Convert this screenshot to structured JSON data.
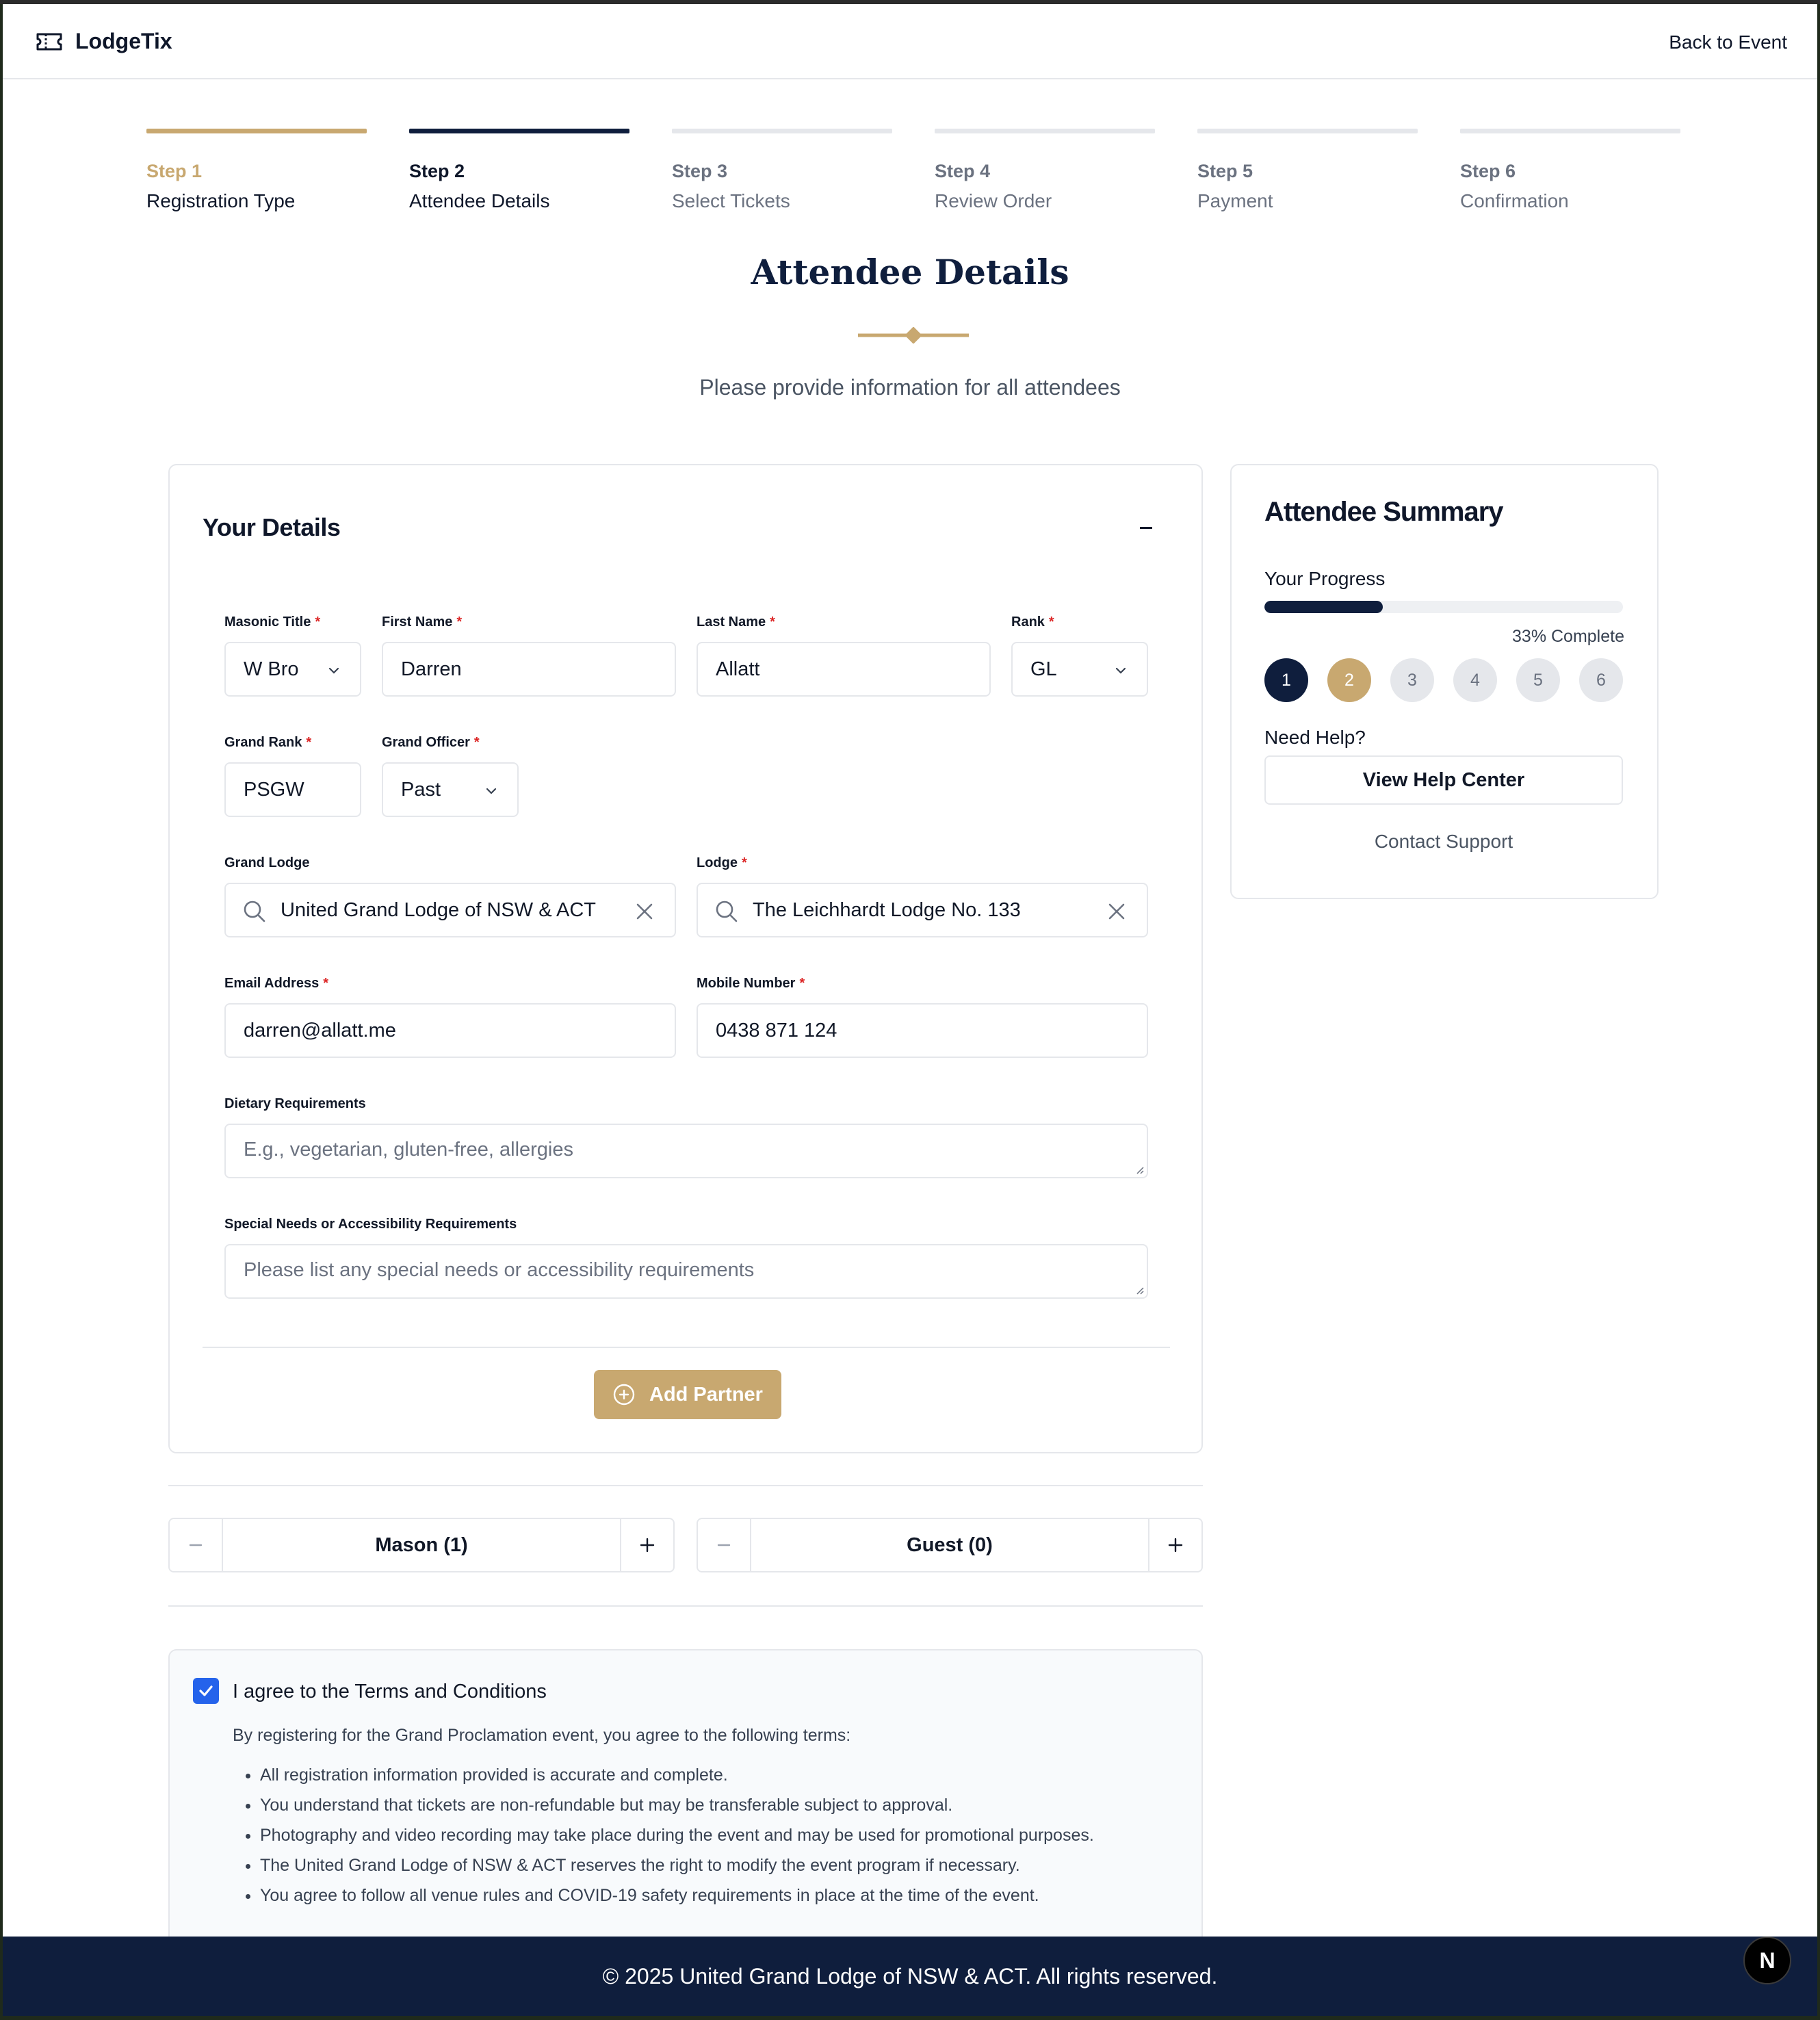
{
  "header": {
    "brand": "LodgeTix",
    "back_link": "Back to Event"
  },
  "steps": [
    {
      "num": "Step 1",
      "label": "Registration Type",
      "state": "done"
    },
    {
      "num": "Step 2",
      "label": "Attendee Details",
      "state": "active"
    },
    {
      "num": "Step 3",
      "label": "Select Tickets",
      "state": "pending"
    },
    {
      "num": "Step 4",
      "label": "Review Order",
      "state": "pending"
    },
    {
      "num": "Step 5",
      "label": "Payment",
      "state": "pending"
    },
    {
      "num": "Step 6",
      "label": "Confirmation",
      "state": "pending"
    }
  ],
  "page": {
    "title": "Attendee Details",
    "subtitle": "Please provide information for all attendees"
  },
  "details": {
    "title": "Your Details",
    "masonic_title": {
      "label": "Masonic Title",
      "value": "W Bro"
    },
    "first_name": {
      "label": "First Name",
      "value": "Darren"
    },
    "last_name": {
      "label": "Last Name",
      "value": "Allatt"
    },
    "rank": {
      "label": "Rank",
      "value": "GL"
    },
    "grand_rank": {
      "label": "Grand Rank",
      "value": "PSGW"
    },
    "grand_officer": {
      "label": "Grand Officer",
      "value": "Past"
    },
    "grand_lodge": {
      "label": "Grand Lodge",
      "value": "United Grand Lodge of NSW & ACT"
    },
    "lodge": {
      "label": "Lodge",
      "value": "The Leichhardt Lodge No. 133"
    },
    "email": {
      "label": "Email Address",
      "value": "darren@allatt.me"
    },
    "mobile": {
      "label": "Mobile Number",
      "value": "0438 871 124"
    },
    "dietary": {
      "label": "Dietary Requirements",
      "placeholder": "E.g., vegetarian, gluten-free, allergies"
    },
    "special_needs": {
      "label": "Special Needs or Accessibility Requirements",
      "placeholder": "Please list any special needs or accessibility requirements"
    },
    "add_partner": "Add Partner",
    "required_mark": "*"
  },
  "counters": {
    "mason": "Mason (1)",
    "guest": "Guest (0)"
  },
  "terms": {
    "checked": true,
    "title": "I agree to the Terms and Conditions",
    "intro": "By registering for the Grand Proclamation event, you agree to the following terms:",
    "items": [
      "All registration information provided is accurate and complete.",
      "You understand that tickets are non-refundable but may be transferable subject to approval.",
      "Photography and video recording may take place during the event and may be used for promotional purposes.",
      "The United Grand Lodge of NSW & ACT reserves the right to modify the event program if necessary.",
      "You agree to follow all venue rules and COVID-19 safety requirements in place at the time of the event."
    ]
  },
  "summary": {
    "title": "Attendee Summary",
    "progress_label": "Your Progress",
    "progress_value": 0.33,
    "progress_text": "33% Complete",
    "dots": [
      "1",
      "2",
      "3",
      "4",
      "5",
      "6"
    ],
    "help_label": "Need Help?",
    "help_button": "View Help Center",
    "support_link": "Contact Support"
  },
  "footer": {
    "copyright": "© 2025 United Grand Lodge of NSW & ACT. All rights reserved."
  },
  "dev_badge": "N",
  "colors": {
    "navy": "#0f1e3d",
    "gold": "#c8a870",
    "checkbox": "#2563eb"
  },
  "icons": [
    "ticket-icon",
    "chevron-down-icon",
    "search-icon",
    "close-icon",
    "minus-icon",
    "plus-icon",
    "plus-circle-icon",
    "check-icon"
  ]
}
